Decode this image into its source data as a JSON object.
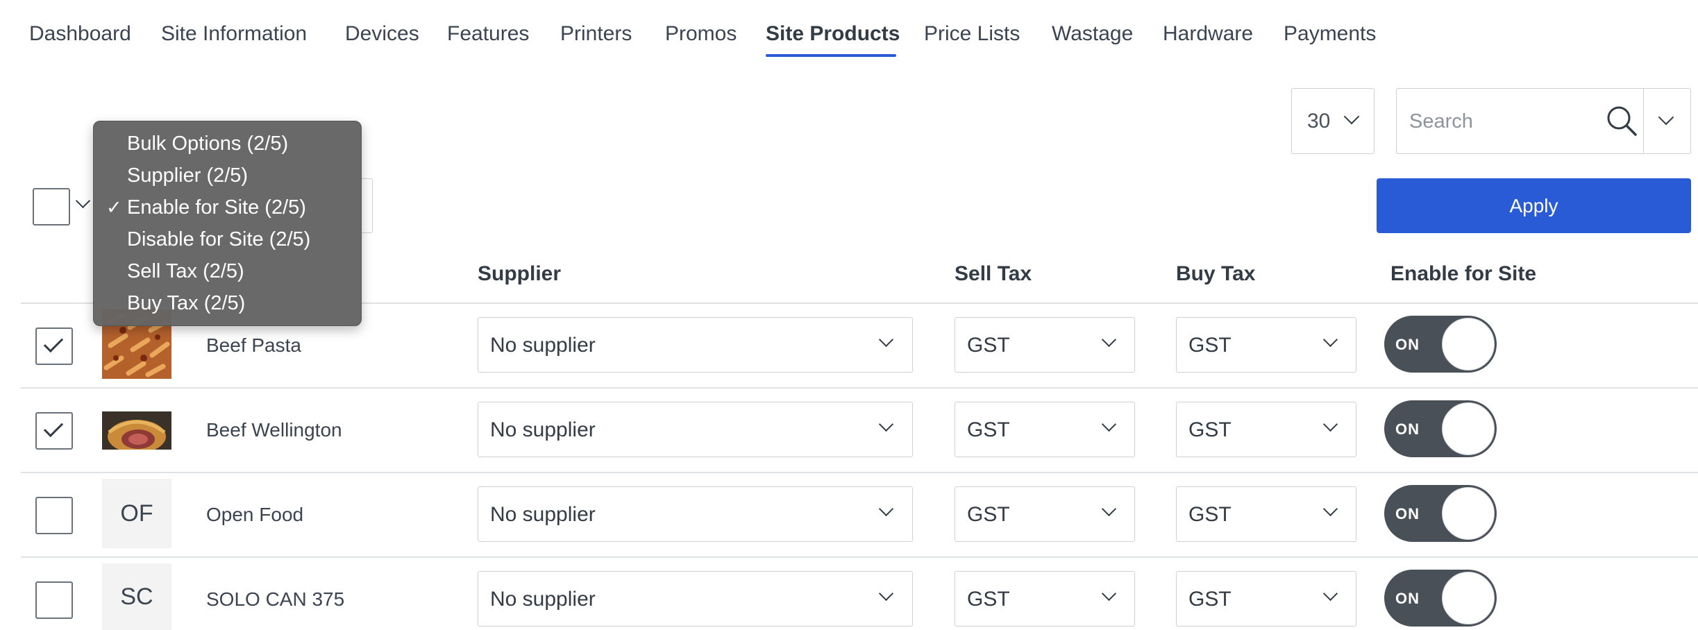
{
  "nav": {
    "tabs": [
      {
        "label": "Dashboard"
      },
      {
        "label": "Site Information"
      },
      {
        "label": "Devices"
      },
      {
        "label": "Features"
      },
      {
        "label": "Printers"
      },
      {
        "label": "Promos"
      },
      {
        "label": "Site Products"
      },
      {
        "label": "Price Lists"
      },
      {
        "label": "Wastage"
      },
      {
        "label": "Hardware"
      },
      {
        "label": "Payments"
      }
    ],
    "active_tab": "Site Products"
  },
  "toolbar": {
    "page_size": "30",
    "search_placeholder": "Search",
    "apply_label": "Apply"
  },
  "bulk_menu": {
    "items": [
      {
        "label": "Bulk Options (2/5)",
        "checked": false
      },
      {
        "label": "Supplier (2/5)",
        "checked": false
      },
      {
        "label": "Enable for Site (2/5)",
        "checked": true
      },
      {
        "label": "Disable for Site (2/5)",
        "checked": false
      },
      {
        "label": "Sell Tax (2/5)",
        "checked": false
      },
      {
        "label": "Buy Tax (2/5)",
        "checked": false
      }
    ],
    "check_glyph": "✓"
  },
  "table": {
    "headers": {
      "supplier": "Supplier",
      "sell_tax": "Sell Tax",
      "buy_tax": "Buy Tax",
      "enable": "Enable for Site"
    },
    "rows": [
      {
        "name": "Beef Pasta",
        "checked": true,
        "thumb": "image",
        "supplier": "No supplier",
        "sell_tax": "GST",
        "buy_tax": "GST",
        "enabled": "ON"
      },
      {
        "name": "Beef Wellington",
        "checked": true,
        "thumb": "image",
        "supplier": "No supplier",
        "sell_tax": "GST",
        "buy_tax": "GST",
        "enabled": "ON"
      },
      {
        "name": "Open Food",
        "checked": false,
        "thumb": "OF",
        "supplier": "No supplier",
        "sell_tax": "GST",
        "buy_tax": "GST",
        "enabled": "ON"
      },
      {
        "name": "SOLO CAN 375",
        "checked": false,
        "thumb": "SC",
        "supplier": "No supplier",
        "sell_tax": "GST",
        "buy_tax": "GST",
        "enabled": "ON"
      }
    ]
  },
  "colors": {
    "accent": "#2a5bd7",
    "toggle_on": "#4a5058",
    "menu_bg": "#646464"
  }
}
